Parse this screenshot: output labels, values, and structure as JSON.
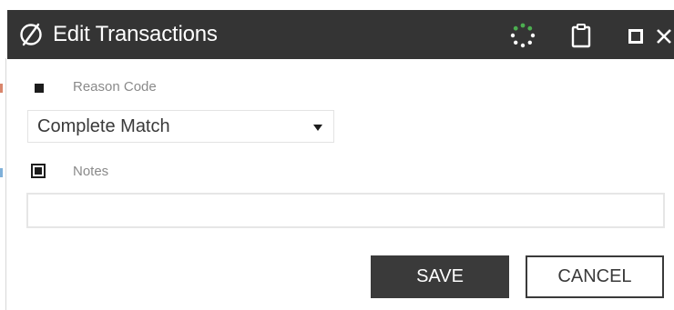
{
  "window": {
    "title": "Edit Transactions",
    "icons": {
      "logo": "slashed-circle-icon",
      "spinner": "loading-spinner-icon",
      "clipboard": "clipboard-icon",
      "maximize": "maximize-icon",
      "close": "close-icon"
    }
  },
  "fields": {
    "reason_code": {
      "label": "Reason Code",
      "value": "Complete Match",
      "enabled": false
    },
    "notes": {
      "label": "Notes",
      "value": "",
      "enabled": true
    }
  },
  "actions": {
    "save_label": "SAVE",
    "cancel_label": "CANCEL"
  },
  "colors": {
    "titlebar_bg": "#343434",
    "primary_button": "#3a3a3a",
    "accent_green": "#4cae50"
  }
}
